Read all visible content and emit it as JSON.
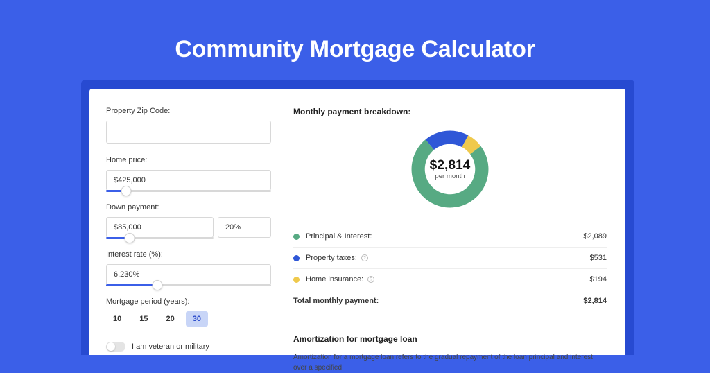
{
  "header": {
    "title": "Community Mortgage Calculator"
  },
  "form": {
    "zip_label": "Property Zip Code:",
    "zip_value": "",
    "home_price_label": "Home price:",
    "home_price_value": "$425,000",
    "home_price_slider_pct": 12,
    "down_label": "Down payment:",
    "down_value": "$85,000",
    "down_pct_value": "20%",
    "down_slider_pct": 22,
    "rate_label": "Interest rate (%):",
    "rate_value": "6.230%",
    "rate_slider_pct": 31,
    "period_label": "Mortgage period (years):",
    "periods": [
      "10",
      "15",
      "20",
      "30"
    ],
    "period_selected": "30",
    "veteran_label": "I am veteran or military"
  },
  "breakdown": {
    "title": "Monthly payment breakdown:",
    "center_amount": "$2,814",
    "center_label": "per month",
    "rows": [
      {
        "label": "Principal & Interest:",
        "value": "$2,089",
        "color": "#57aa83",
        "info": false
      },
      {
        "label": "Property taxes:",
        "value": "$531",
        "color": "#2f57d7",
        "info": true
      },
      {
        "label": "Home insurance:",
        "value": "$194",
        "color": "#efc94c",
        "info": true
      }
    ],
    "total_label": "Total monthly payment:",
    "total_value": "$2,814"
  },
  "amort": {
    "title": "Amortization for mortgage loan",
    "text": "Amortization for a mortgage loan refers to the gradual repayment of the loan principal and interest over a specified"
  },
  "colors": {
    "green": "#57aa83",
    "blue": "#2f57d7",
    "yellow": "#efc94c"
  },
  "chart_data": {
    "type": "pie",
    "title": "Monthly payment breakdown",
    "series": [
      {
        "name": "Principal & Interest",
        "value": 2089,
        "color": "#57aa83"
      },
      {
        "name": "Property taxes",
        "value": 531,
        "color": "#2f57d7"
      },
      {
        "name": "Home insurance",
        "value": 194,
        "color": "#efc94c"
      }
    ],
    "total": 2814,
    "unit": "USD per month"
  }
}
